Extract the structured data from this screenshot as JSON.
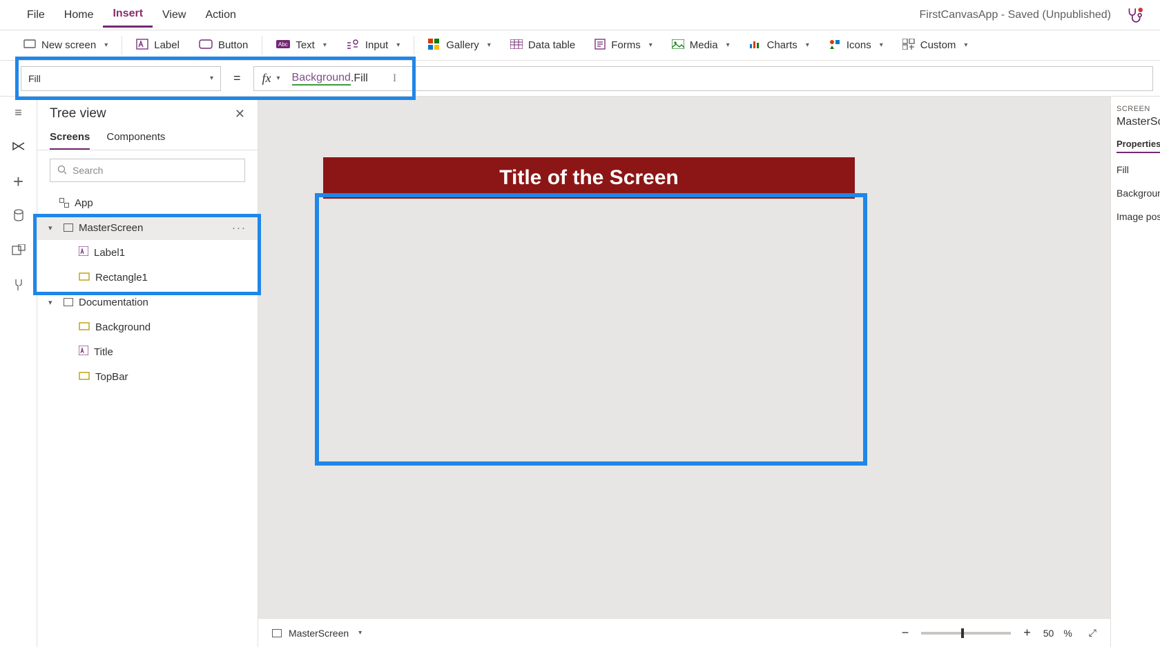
{
  "app": {
    "status": "FirstCanvasApp - Saved (Unpublished)"
  },
  "menu": {
    "file": "File",
    "home": "Home",
    "insert": "Insert",
    "view": "View",
    "action": "Action"
  },
  "ribbon": {
    "new_screen": "New screen",
    "label": "Label",
    "button": "Button",
    "text": "Text",
    "input": "Input",
    "gallery": "Gallery",
    "data_table": "Data table",
    "forms": "Forms",
    "media": "Media",
    "charts": "Charts",
    "icons": "Icons",
    "custom": "Custom"
  },
  "formula": {
    "property": "Fill",
    "fx": "fx",
    "bg_ref": "Background",
    "dot_fill": ".Fill"
  },
  "treeview": {
    "title": "Tree view",
    "tab_screens": "Screens",
    "tab_components": "Components",
    "search_placeholder": "Search",
    "items": {
      "app": "App",
      "master": "MasterScreen",
      "label1": "Label1",
      "rect1": "Rectangle1",
      "doc": "Documentation",
      "background": "Background",
      "title": "Title",
      "topbar": "TopBar"
    }
  },
  "canvas": {
    "title": "Title of the Screen",
    "footer_screen": "MasterScreen",
    "zoom_value": "50",
    "zoom_pct": "%"
  },
  "props": {
    "label": "SCREEN",
    "name": "MasterScre",
    "tab": "Properties",
    "fill": "Fill",
    "bgimg": "Background",
    "imgpos": "Image posit"
  }
}
